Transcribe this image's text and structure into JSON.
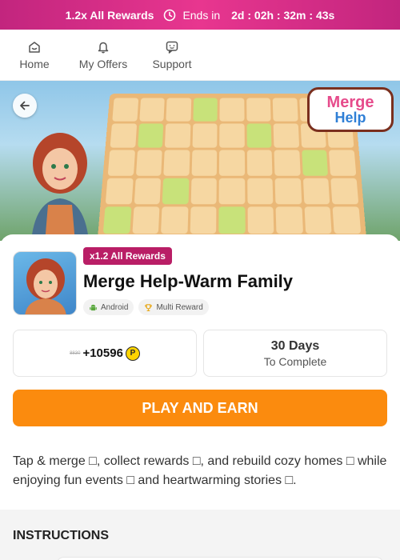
{
  "promo": {
    "multiplier_text": "1.2x All Rewards",
    "ends_label": "Ends in",
    "countdown": "2d : 02h : 32m : 43s"
  },
  "nav": {
    "items": [
      {
        "label": "Home",
        "icon": "home-icon"
      },
      {
        "label": "My Offers",
        "icon": "bell-icon"
      },
      {
        "label": "Support",
        "icon": "chat-icon"
      }
    ]
  },
  "hero": {
    "logo_line1": "Merge",
    "logo_line2": "Help"
  },
  "offer": {
    "rewards_badge": "x1.2 All Rewards",
    "title": "Merge Help-Warm Family",
    "tags": [
      {
        "label": "Android",
        "icon": "android-icon"
      },
      {
        "label": "Multi Reward",
        "icon": "trophy-icon"
      }
    ],
    "old_points": "8830",
    "points": "+10596",
    "coin_symbol": "P",
    "days": "30 Days",
    "days_label": "To Complete",
    "play_button": "PLAY AND EARN",
    "description": "Tap & merge □, collect rewards □, and rebuild cozy homes □ while enjoying fun events □ and heartwarming stories □."
  },
  "instructions": {
    "title": "INSTRUCTIONS"
  },
  "colors": {
    "promo_bg": "#e8368f",
    "badge_bg": "#b91e66",
    "play_button_bg": "#fb8b0e",
    "coin": "#ffd400"
  }
}
